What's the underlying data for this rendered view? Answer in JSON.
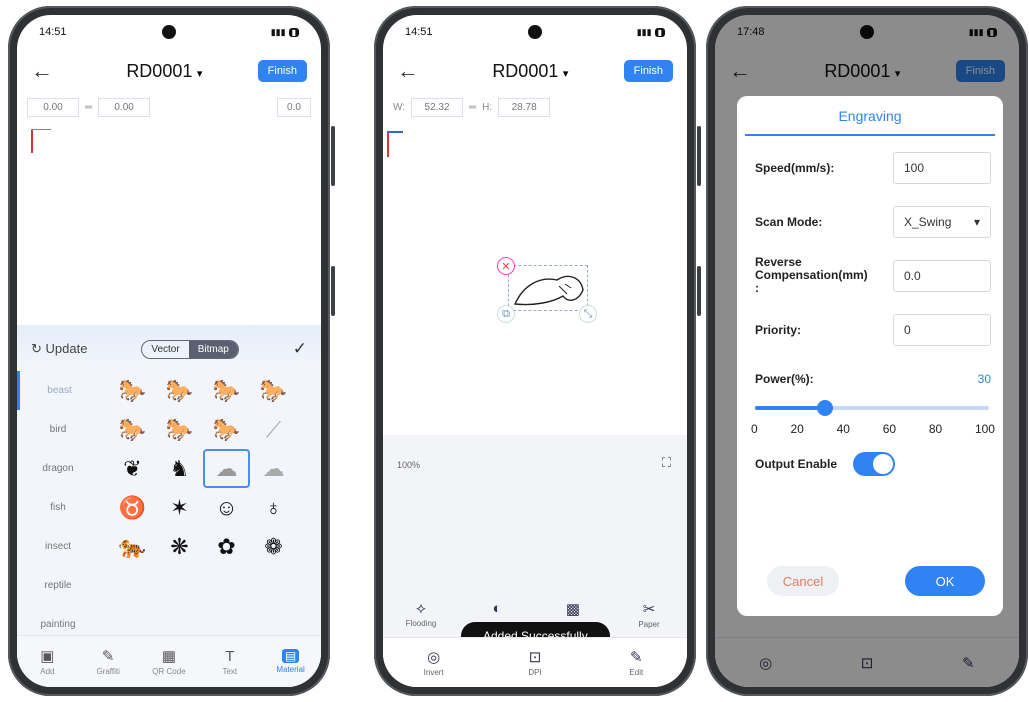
{
  "phone1": {
    "time": "14:51",
    "title": "RD0001",
    "finish": "Finish",
    "w_value": "0.00",
    "h_value": "0.00",
    "rotate_value": "0.0",
    "update_label": "Update",
    "seg_vector": "Vector",
    "seg_bitmap": "Bitmap",
    "categories": [
      "beast",
      "bird",
      "dragon",
      "fish",
      "insect",
      "reptile",
      "painting"
    ],
    "tabs": [
      {
        "label": "Add",
        "icon": "add-icon"
      },
      {
        "label": "Graffiti",
        "icon": "graffiti-icon"
      },
      {
        "label": "QR Code",
        "icon": "qr-icon"
      },
      {
        "label": "Text",
        "icon": "text-icon"
      },
      {
        "label": "Material",
        "icon": "material-icon"
      }
    ]
  },
  "phone2": {
    "time": "14:51",
    "title": "RD0001",
    "finish": "Finish",
    "w_label": "W:",
    "w_value": "52.32",
    "h_label": "H:",
    "h_value": "28.78",
    "zoom": "100%",
    "tools_top": [
      {
        "label": "Flooding",
        "icon": "flood-icon"
      },
      {
        "label": "",
        "icon": "contrast-icon"
      },
      {
        "label": "",
        "icon": "image-icon"
      },
      {
        "label": "Paper",
        "icon": "paper-icon"
      }
    ],
    "tools_bottom": [
      {
        "label": "Invert",
        "icon": "invert-icon"
      },
      {
        "label": "DPI",
        "icon": "dpi-icon"
      },
      {
        "label": "Edit",
        "icon": "edit-icon"
      }
    ],
    "toast": "Added Successfully"
  },
  "phone3": {
    "time": "17:48",
    "title": "RD0001",
    "finish": "Finish",
    "dialog": {
      "title": "Engraving",
      "speed_label": "Speed(mm/s):",
      "speed_value": "100",
      "scan_label": "Scan Mode:",
      "scan_value": "X_Swing",
      "reverse_label_1": "Reverse",
      "reverse_label_2": "Compensation(mm)",
      "reverse_label_3": ":",
      "reverse_value": "0.0",
      "priority_label": "Priority:",
      "priority_value": "0",
      "power_label": "Power(%):",
      "power_value": "30",
      "power_level": 0.3,
      "ticks": [
        "0",
        "20",
        "40",
        "60",
        "80",
        "100"
      ],
      "output_label": "Output Enable",
      "output_enabled": true,
      "cancel": "Cancel",
      "ok": "OK"
    }
  }
}
